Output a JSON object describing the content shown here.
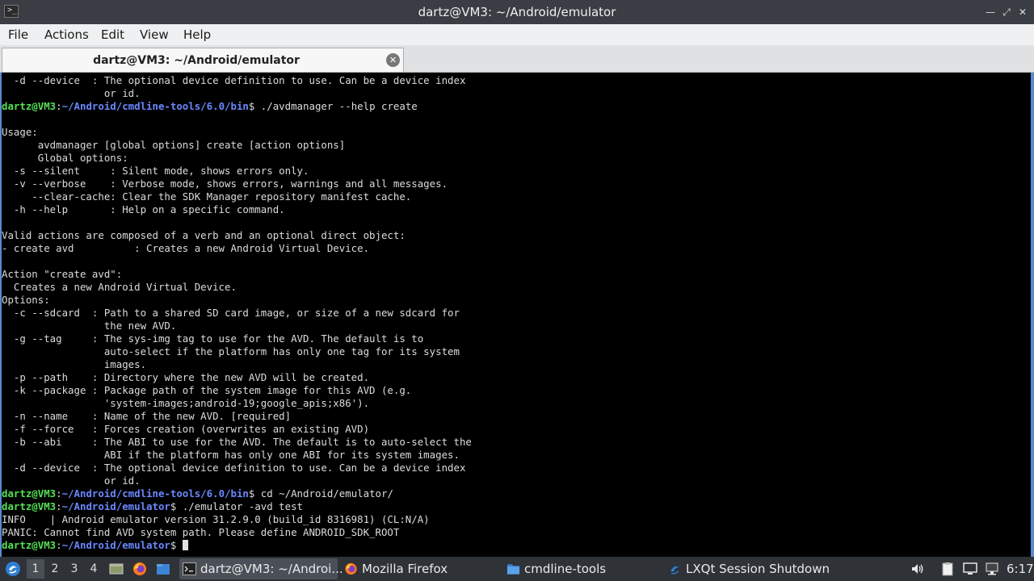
{
  "window": {
    "title": "dartz@VM3: ~/Android/emulator",
    "app_icon": ">_",
    "controls": [
      "minimize-icon",
      "maximize-icon",
      "close-icon"
    ]
  },
  "menu": [
    "File",
    "Actions",
    "Edit",
    "View",
    "Help"
  ],
  "tab": {
    "label": "dartz@VM3: ~/Android/emulator",
    "close_icon": "close-circle-icon"
  },
  "terminal": {
    "user": "dartz@VM3",
    "colors": {
      "prompt_user": "#55e055",
      "prompt_path": "#6a88ff",
      "text": "#dcdcdc"
    },
    "lines": [
      {
        "text": "  -d --device  : The optional device definition to use. Can be a device index"
      },
      {
        "text": "                 or id."
      },
      {
        "prompt_user": "dartz@VM3",
        "prompt_path": "~/Android/cmdline-tools/6.0/bin",
        "command": " ./avdmanager --help create"
      },
      {
        "text": ""
      },
      {
        "text": "Usage:"
      },
      {
        "text": "      avdmanager [global options] create [action options]"
      },
      {
        "text": "      Global options:"
      },
      {
        "text": "  -s --silent     : Silent mode, shows errors only."
      },
      {
        "text": "  -v --verbose    : Verbose mode, shows errors, warnings and all messages."
      },
      {
        "text": "     --clear-cache: Clear the SDK Manager repository manifest cache."
      },
      {
        "text": "  -h --help       : Help on a specific command."
      },
      {
        "text": ""
      },
      {
        "text": "Valid actions are composed of a verb and an optional direct object:"
      },
      {
        "text": "- create avd          : Creates a new Android Virtual Device."
      },
      {
        "text": ""
      },
      {
        "text": "Action \"create avd\":"
      },
      {
        "text": "  Creates a new Android Virtual Device."
      },
      {
        "text": "Options:"
      },
      {
        "text": "  -c --sdcard  : Path to a shared SD card image, or size of a new sdcard for"
      },
      {
        "text": "                 the new AVD."
      },
      {
        "text": "  -g --tag     : The sys-img tag to use for the AVD. The default is to"
      },
      {
        "text": "                 auto-select if the platform has only one tag for its system"
      },
      {
        "text": "                 images."
      },
      {
        "text": "  -p --path    : Directory where the new AVD will be created."
      },
      {
        "text": "  -k --package : Package path of the system image for this AVD (e.g."
      },
      {
        "text": "                 'system-images;android-19;google_apis;x86')."
      },
      {
        "text": "  -n --name    : Name of the new AVD. [required]"
      },
      {
        "text": "  -f --force   : Forces creation (overwrites an existing AVD)"
      },
      {
        "text": "  -b --abi     : The ABI to use for the AVD. The default is to auto-select the"
      },
      {
        "text": "                 ABI if the platform has only one ABI for its system images."
      },
      {
        "text": "  -d --device  : The optional device definition to use. Can be a device index"
      },
      {
        "text": "                 or id."
      },
      {
        "prompt_user": "dartz@VM3",
        "prompt_path": "~/Android/cmdline-tools/6.0/bin",
        "command": " cd ~/Android/emulator/"
      },
      {
        "prompt_user": "dartz@VM3",
        "prompt_path": "~/Android/emulator",
        "command": " ./emulator -avd test"
      },
      {
        "text": "INFO    | Android emulator version 31.2.9.0 (build_id 8316981) (CL:N/A)"
      },
      {
        "text": "PANIC: Cannot find AVD system path. Please define ANDROID_SDK_ROOT"
      },
      {
        "prompt_user": "dartz@VM3",
        "prompt_path": "~/Android/emulator",
        "command": " ",
        "cursor": true
      }
    ]
  },
  "taskbar": {
    "start_icon": "lxqt-start-icon",
    "workspaces": [
      "1",
      "2",
      "3",
      "4"
    ],
    "active_workspace": "1",
    "quicklaunch": [
      "show-desktop-icon",
      "firefox-icon",
      "file-manager-icon"
    ],
    "tasks": [
      {
        "label": "dartz@VM3: ~/Androi...",
        "icon": "terminal-icon",
        "active": true
      },
      {
        "label": "Mozilla Firefox",
        "icon": "firefox-icon",
        "active": false
      },
      {
        "label": "cmdline-tools",
        "icon": "folder-icon",
        "active": false
      },
      {
        "label": "LXQt Session Shutdown",
        "icon": "lxqt-icon",
        "active": false
      }
    ],
    "tray": [
      "volume-icon",
      "clipboard-icon",
      "display-icon",
      "network-icon"
    ],
    "clock": "6:17"
  }
}
